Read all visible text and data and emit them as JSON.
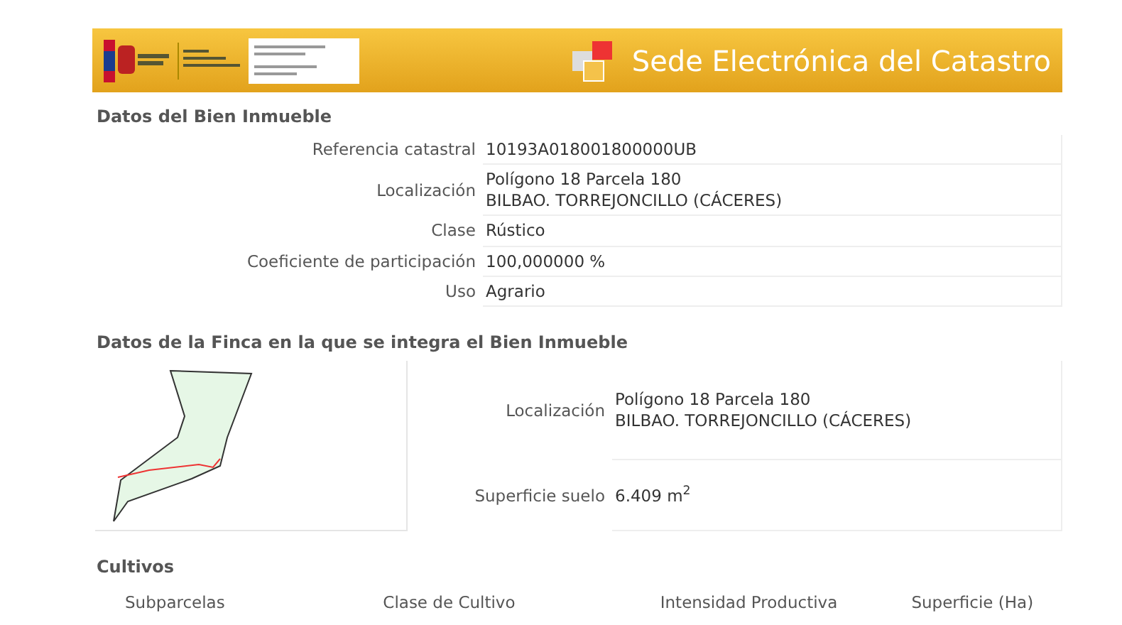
{
  "banner": {
    "title": "Sede Electrónica del Catastro"
  },
  "inmueble": {
    "heading": "Datos del Bien Inmueble",
    "rows": [
      {
        "label": "Referencia catastral",
        "lines": [
          "10193A018001800000UB"
        ]
      },
      {
        "label": "Localización",
        "lines": [
          "Polígono 18 Parcela 180",
          "BILBAO. TORREJONCILLO (CÁCERES)"
        ]
      },
      {
        "label": "Clase",
        "lines": [
          "Rústico"
        ]
      },
      {
        "label": "Coeficiente de participación",
        "lines": [
          "100,000000 %"
        ]
      },
      {
        "label": "Uso",
        "lines": [
          "Agrario"
        ]
      }
    ]
  },
  "finca": {
    "heading": "Datos de la Finca en la que se integra el Bien Inmueble",
    "rows": [
      {
        "label": "Localización",
        "lines": [
          "Polígono 18 Parcela 180",
          "BILBAO. TORREJONCILLO (CÁCERES)"
        ]
      },
      {
        "label": "Superficie suelo",
        "lines": [
          "6.409 m$^{2}$"
        ]
      }
    ]
  },
  "cultivos": {
    "heading": "Cultivos",
    "columns": [
      "Subparcelas",
      "Clase de Cultivo",
      "Intensidad Productiva",
      "Superficie (Ha)"
    ]
  }
}
